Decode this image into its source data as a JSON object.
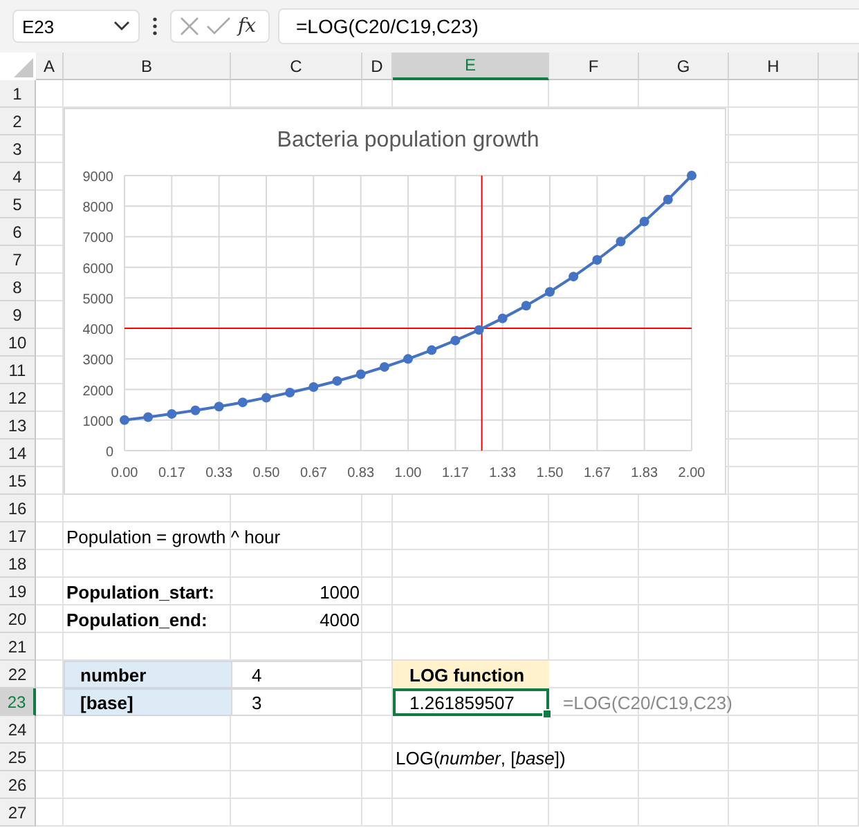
{
  "formula_bar": {
    "name_box": "E23",
    "function_label": "fx",
    "formula": "=LOG(C20/C19,C23)"
  },
  "columns": [
    {
      "label": "A",
      "selected": false
    },
    {
      "label": "B",
      "selected": false
    },
    {
      "label": "C",
      "selected": false
    },
    {
      "label": "D",
      "selected": false
    },
    {
      "label": "E",
      "selected": true
    },
    {
      "label": "F",
      "selected": false
    },
    {
      "label": "G",
      "selected": false
    },
    {
      "label": "H",
      "selected": false
    }
  ],
  "row_numbers": [
    {
      "label": "1",
      "selected": false
    },
    {
      "label": "2",
      "selected": false
    },
    {
      "label": "3",
      "selected": false
    },
    {
      "label": "4",
      "selected": false
    },
    {
      "label": "5",
      "selected": false
    },
    {
      "label": "6",
      "selected": false
    },
    {
      "label": "7",
      "selected": false
    },
    {
      "label": "8",
      "selected": false
    },
    {
      "label": "9",
      "selected": false
    },
    {
      "label": "10",
      "selected": false
    },
    {
      "label": "11",
      "selected": false
    },
    {
      "label": "12",
      "selected": false
    },
    {
      "label": "13",
      "selected": false
    },
    {
      "label": "14",
      "selected": false
    },
    {
      "label": "15",
      "selected": false
    },
    {
      "label": "16",
      "selected": false
    },
    {
      "label": "17",
      "selected": false
    },
    {
      "label": "18",
      "selected": false
    },
    {
      "label": "19",
      "selected": false
    },
    {
      "label": "20",
      "selected": false
    },
    {
      "label": "21",
      "selected": false
    },
    {
      "label": "22",
      "selected": false
    },
    {
      "label": "23",
      "selected": true
    },
    {
      "label": "24",
      "selected": false
    },
    {
      "label": "25",
      "selected": false
    },
    {
      "label": "26",
      "selected": false
    },
    {
      "label": "27",
      "selected": false
    }
  ],
  "chart_data": {
    "type": "line",
    "title": "Bacteria population growth",
    "x": [
      0,
      0.0833,
      0.1667,
      0.25,
      0.3333,
      0.4167,
      0.5,
      0.5833,
      0.6667,
      0.75,
      0.8333,
      0.9167,
      1,
      1.0833,
      1.1667,
      1.25,
      1.3333,
      1.4167,
      1.5,
      1.5833,
      1.6667,
      1.75,
      1.8333,
      1.9167,
      2
    ],
    "grid": true,
    "series": [
      {
        "color": "#4472c4",
        "marker": "circle",
        "values": [
          1000,
          1096,
          1201,
          1316,
          1442,
          1580,
          1732,
          1898,
          2080,
          2280,
          2498,
          2738,
          3000,
          3288,
          3603,
          3948,
          4327,
          4742,
          5196,
          5695,
          6240,
          6839,
          7494,
          8213,
          9000
        ]
      }
    ],
    "xlim": [
      0,
      2
    ],
    "ylim": [
      0,
      9000
    ],
    "xticks": [
      {
        "value": 0,
        "label": "0.00"
      },
      {
        "value": 0.1667,
        "label": "0.17"
      },
      {
        "value": 0.3333,
        "label": "0.33"
      },
      {
        "value": 0.5,
        "label": "0.50"
      },
      {
        "value": 0.6667,
        "label": "0.67"
      },
      {
        "value": 0.8333,
        "label": "0.83"
      },
      {
        "value": 1,
        "label": "1.00"
      },
      {
        "value": 1.1667,
        "label": "1.17"
      },
      {
        "value": 1.3333,
        "label": "1.33"
      },
      {
        "value": 1.5,
        "label": "1.50"
      },
      {
        "value": 1.6667,
        "label": "1.67"
      },
      {
        "value": 1.8333,
        "label": "1.83"
      },
      {
        "value": 2,
        "label": "2.00"
      }
    ],
    "yticks": [
      0,
      1000,
      2000,
      3000,
      4000,
      5000,
      6000,
      7000,
      8000,
      9000
    ],
    "ref_lines": [
      {
        "axis": "x",
        "value": 1.26,
        "color": "#ff0000"
      },
      {
        "axis": "y",
        "value": 4000,
        "color": "#ff0000"
      }
    ]
  },
  "note": "Population = growth ^ hour",
  "population": [
    {
      "label": "Population_start:",
      "value": "1000"
    },
    {
      "label": "Population_end:",
      "value": "4000"
    }
  ],
  "arguments": [
    {
      "name": "number",
      "value": "4"
    },
    {
      "name": "[base]",
      "value": "3"
    }
  ],
  "log_function": {
    "header": "LOG function",
    "result": "1.261859507",
    "formula": "=LOG(C20/C19,C23)"
  },
  "syntax": "LOG(*number*, [*base*])"
}
